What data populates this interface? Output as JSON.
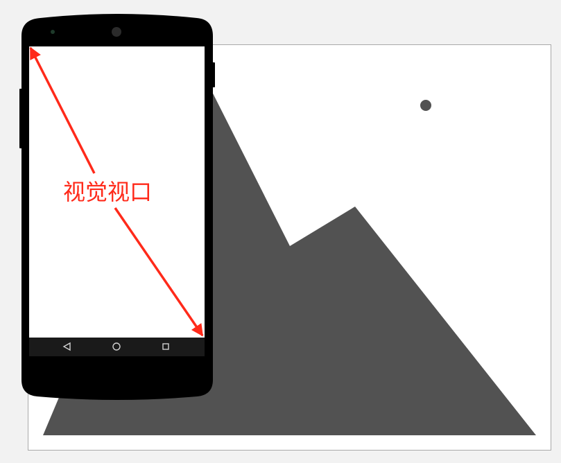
{
  "diagram": {
    "annotation_label": "视觉视口",
    "colors": {
      "page_background": "#f2f2f2",
      "picture_background": "#ffffff",
      "picture_border": "#a8a8a8",
      "mountain": "#525252",
      "sun": "#525252",
      "phone_body": "#000000",
      "phone_screen": "#ffffff",
      "phone_navbar": "#1a1a1a",
      "nav_icons": "#d0d0d0",
      "annotation": "#ff2a1a"
    },
    "image_placeholder": {
      "parts": [
        "mountain",
        "sun"
      ]
    },
    "phone": {
      "nav_buttons": [
        "back-triangle",
        "home-circle",
        "recents-square"
      ]
    }
  }
}
